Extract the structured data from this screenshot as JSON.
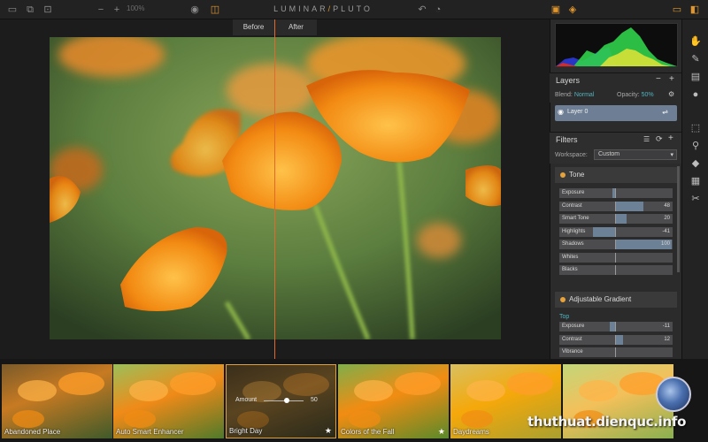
{
  "toolbar": {
    "zoom": "100%",
    "app_title_a": "LUMINAR",
    "app_title_sep": "/",
    "app_title_b": "PLUTO"
  },
  "compare": {
    "before": "Before",
    "after": "After"
  },
  "layers": {
    "title": "Layers",
    "blend_label": "Blend:",
    "blend_value": "Normal",
    "opacity_label": "Opacity:",
    "opacity_value": "50%",
    "layer_name": "Layer 0"
  },
  "filters": {
    "title": "Filters",
    "workspace_label": "Workspace:",
    "workspace_value": "Custom",
    "tone": {
      "title": "Tone",
      "sliders": [
        {
          "label": "Exposure",
          "value": ""
        },
        {
          "label": "Contrast",
          "value": "48"
        },
        {
          "label": "Smart Tone",
          "value": "20"
        },
        {
          "label": "Highlights",
          "value": "-41"
        },
        {
          "label": "Shadows",
          "value": "100"
        },
        {
          "label": "Whites",
          "value": ""
        },
        {
          "label": "Blacks",
          "value": ""
        }
      ]
    },
    "gradient": {
      "title": "Adjustable Gradient",
      "sub": "Top",
      "sliders": [
        {
          "label": "Exposure",
          "value": "-11"
        },
        {
          "label": "Contrast",
          "value": "12"
        },
        {
          "label": "Vibrance",
          "value": ""
        }
      ]
    }
  },
  "presets": [
    {
      "name": "Abandoned Place",
      "starred": false
    },
    {
      "name": "Auto Smart Enhancer",
      "starred": false
    },
    {
      "name": "Bright Day",
      "starred": true
    },
    {
      "name": "Colors of the Fall",
      "starred": true
    },
    {
      "name": "Daydreams",
      "starred": false
    },
    {
      "name": "",
      "starred": false
    }
  ],
  "amount": {
    "label": "Amount",
    "value": "50"
  },
  "watermark": "thuthuat.dienquc.info",
  "colors": {
    "accent": "#e8a23a",
    "split": "#e06a2c",
    "layer": "#6e7f95",
    "teal": "#4fb3bf"
  }
}
